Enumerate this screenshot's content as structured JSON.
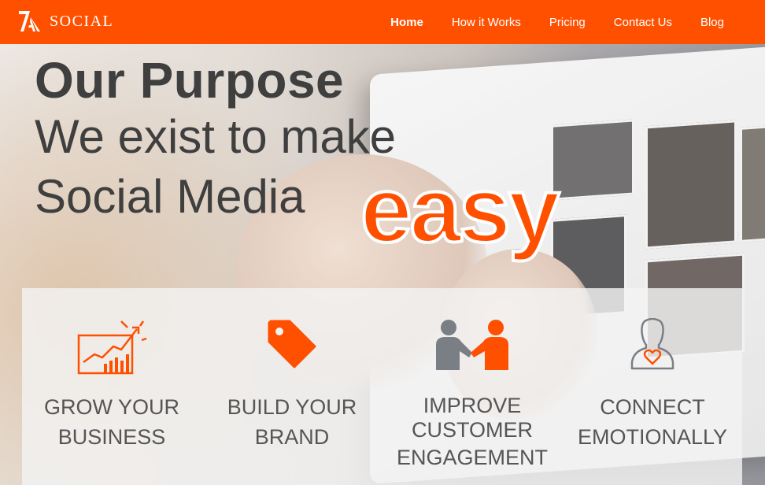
{
  "header": {
    "logo_mark": "7A",
    "logo_text": "SOCIAL",
    "nav": [
      {
        "label": "Home",
        "active": true
      },
      {
        "label": "How it Works",
        "active": false
      },
      {
        "label": "Pricing",
        "active": false
      },
      {
        "label": "Contact Us",
        "active": false
      },
      {
        "label": "Blog",
        "active": false
      }
    ]
  },
  "hero": {
    "title": "Our Purpose",
    "line1": "We exist to make",
    "line2": "Social Media",
    "highlight": "easy"
  },
  "features": [
    {
      "icon": "growth-chart-icon",
      "line1": "GROW YOUR",
      "line2": "BUSINESS"
    },
    {
      "icon": "price-tag-icon",
      "line1": "BUILD YOUR",
      "line2": "BRAND"
    },
    {
      "icon": "handshake-people-icon",
      "line1": "IMPROVE",
      "line2": "CUSTOMER",
      "line3": "ENGAGEMENT"
    },
    {
      "icon": "person-heart-icon",
      "line1": "CONNECT",
      "line2": "EMOTIONALLY"
    }
  ],
  "colors": {
    "brand": "#ff5000",
    "text": "#3f3f3f",
    "panel": "#f3f3f3"
  }
}
